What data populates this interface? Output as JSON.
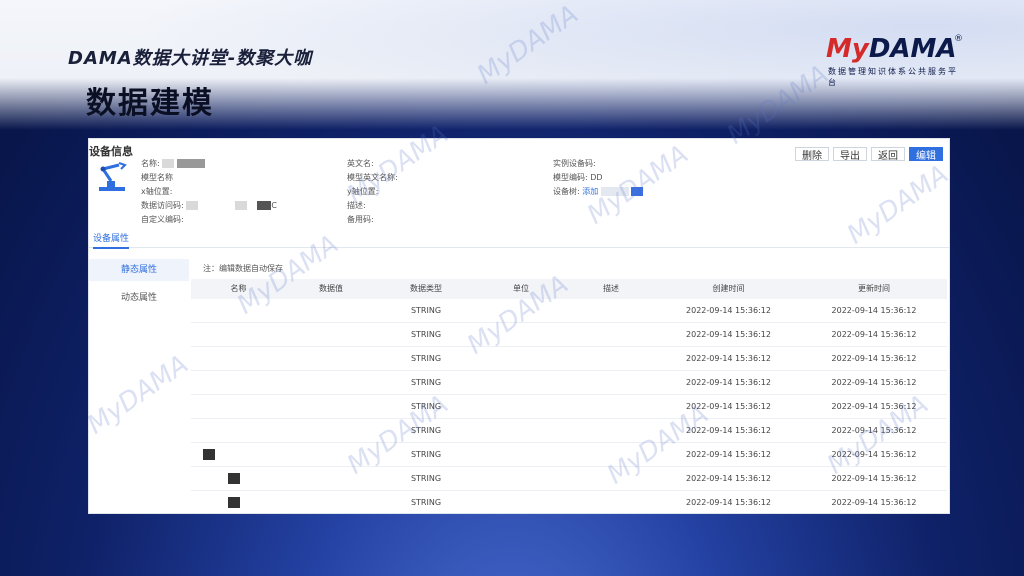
{
  "slide": {
    "subtitle": "DAMA数据大讲堂-数聚大咖",
    "title": "数据建模",
    "logo": {
      "brand_my": "My",
      "brand_rest": "DAMA",
      "reg": "®",
      "tagline": "数据管理知识体系公共服务平台"
    },
    "watermark": "MyDAMA"
  },
  "panel": {
    "title": "设备信息",
    "toolbar": {
      "delete": "删除",
      "export": "导出",
      "back": "返回",
      "edit": "编辑"
    },
    "fields": {
      "name": "名称:",
      "model_name": "模型名称",
      "x_pos": "x轴位置:",
      "data_access_code": "数据访问码:",
      "custom_code": "自定义编码:",
      "english_name": "英文名:",
      "model_english_name": "模型英文名称:",
      "y_pos": "y轴位置:",
      "description": "描述:",
      "backup_code": "备用码:",
      "instance_code": "实例设备码:",
      "model_code": "模型编码:",
      "model_code_value": "DD",
      "device_tree": "设备树:",
      "device_tree_value": "添加",
      "access_code_suffix": "C"
    },
    "tab": "设备属性",
    "side": {
      "static": "静态属性",
      "dynamic": "动态属性"
    },
    "note": "注：编辑数据自动保存",
    "table": {
      "headers": [
        "名称",
        "数据值",
        "数据类型",
        "单位",
        "描述",
        "创建时间",
        "更新时间"
      ],
      "rows": [
        {
          "type": "STRING",
          "created": "2022-09-14 15:36:12",
          "updated": "2022-09-14 15:36:12"
        },
        {
          "type": "STRING",
          "created": "2022-09-14 15:36:12",
          "updated": "2022-09-14 15:36:12"
        },
        {
          "type": "STRING",
          "created": "2022-09-14 15:36:12",
          "updated": "2022-09-14 15:36:12"
        },
        {
          "type": "STRING",
          "created": "2022-09-14 15:36:12",
          "updated": "2022-09-14 15:36:12"
        },
        {
          "type": "STRING",
          "created": "2022-09-14 15:36:12",
          "updated": "2022-09-14 15:36:12"
        },
        {
          "type": "STRING",
          "created": "2022-09-14 15:36:12",
          "updated": "2022-09-14 15:36:12"
        },
        {
          "type": "STRING",
          "created": "2022-09-14 15:36:12",
          "updated": "2022-09-14 15:36:12"
        },
        {
          "type": "STRING",
          "created": "2022-09-14 15:36:12",
          "updated": "2022-09-14 15:36:12"
        },
        {
          "type": "STRING",
          "created": "2022-09-14 15:36:12",
          "updated": "2022-09-14 15:36:12"
        }
      ]
    }
  },
  "colors": {
    "accent": "#2f6fe0",
    "brand_red": "#d42a2a",
    "bg_dark": "#0f2168"
  },
  "icons": {
    "device": "robot-arm-icon"
  }
}
